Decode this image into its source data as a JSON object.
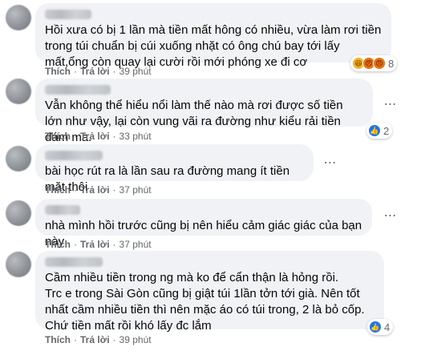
{
  "ui": {
    "like_label": "Thích",
    "reply_label": "Trả lời",
    "separator": "·",
    "more_icon": "⋯"
  },
  "comments": [
    {
      "text": "Hồi xưa có bị 1 lần mà tiền mất hông có nhiều, vừa làm rơi tiền trong túi chuẩn bị cúi xuống nhặt có ông chú bay tới lấy mất,ổng còn quay lại cười rồi mới phóng xe đi cơ",
      "time": "39 phút",
      "reactions": [
        "haha",
        "angry",
        "angry"
      ],
      "reaction_count": "8"
    },
    {
      "text": "Vẫn không thể hiểu nổi làm thế nào mà rơi được số tiền lớn như vậy, lại còn vung vãi ra đường như kiểu rải tiền đám ma.",
      "time": "33 phút",
      "reactions": [
        "like"
      ],
      "reaction_count": "2"
    },
    {
      "text": "bài học rút ra là lần sau ra đường mang ít tiền mặt thôi",
      "time": "37 phút"
    },
    {
      "text": "nhà mình hồi trước cũng bị nên hiểu cảm giác giác của bạn này",
      "time": "37 phút"
    },
    {
      "text": "Cầm nhiều tiền trong ng mà ko để cẩn thận là hỏng rồi.\nTrc e trong Sài Gòn cũng bị giật túi 1lần tởn tới già. Nên tốt nhất cầm nhiều tiền thì nên mặc áo có túi trong, 2 là bỏ cốp. Chứ tiền mất rồi khó lấy đc lắm",
      "time": "39 phút",
      "reactions": [
        "like"
      ],
      "reaction_count": "4"
    }
  ]
}
